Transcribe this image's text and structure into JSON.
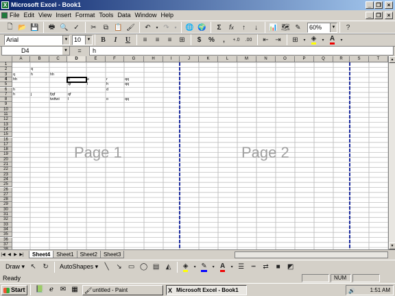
{
  "window": {
    "title": "Microsoft Excel - Book1"
  },
  "menu": [
    "File",
    "Edit",
    "View",
    "Insert",
    "Format",
    "Tools",
    "Data",
    "Window",
    "Help"
  ],
  "standard_toolbar": {
    "zoom": "60%"
  },
  "formatting_toolbar": {
    "font": "Arial",
    "size": "10"
  },
  "formula_bar": {
    "name_box": "D4",
    "fx": "=",
    "content": "h"
  },
  "columns": [
    "A",
    "B",
    "C",
    "D",
    "E",
    "F",
    "G",
    "H",
    "I",
    "J",
    "K",
    "L",
    "M",
    "N",
    "O",
    "P",
    "Q",
    "R",
    "S",
    "T"
  ],
  "rows": [
    "1",
    "2",
    "3",
    "4",
    "5",
    "6",
    "7",
    "8",
    "9",
    "10",
    "11",
    "12",
    "13",
    "14",
    "15",
    "16",
    "17",
    "18",
    "19",
    "20",
    "21",
    "22",
    "23",
    "24",
    "25",
    "26",
    "27",
    "28",
    "29",
    "30",
    "31",
    "32",
    "33",
    "34",
    "35",
    "36",
    "37",
    "38"
  ],
  "cells": [
    {
      "ref": "B2",
      "text": "q"
    },
    {
      "ref": "A3",
      "text": "q"
    },
    {
      "ref": "B3",
      "text": "h"
    },
    {
      "ref": "C3",
      "text": "hh"
    },
    {
      "ref": "A4",
      "text": "hh"
    },
    {
      "ref": "D4",
      "text": "h"
    },
    {
      "ref": "E4",
      "text": "e"
    },
    {
      "ref": "F4",
      "text": "r"
    },
    {
      "ref": "G4",
      "text": "qq"
    },
    {
      "ref": "D5",
      "text": "qf"
    },
    {
      "ref": "E5",
      "text": "l"
    },
    {
      "ref": "F5",
      "text": "h"
    },
    {
      "ref": "G5",
      "text": "qq"
    },
    {
      "ref": "A6",
      "text": "h"
    },
    {
      "ref": "F6",
      "text": "d"
    },
    {
      "ref": "A7",
      "text": "h"
    },
    {
      "ref": "B7",
      "text": "j"
    },
    {
      "ref": "C7",
      "text": "fjqf"
    },
    {
      "ref": "D7",
      "text": "qf"
    },
    {
      "ref": "C8",
      "text": "twttwi"
    },
    {
      "ref": "D8",
      "text": "l"
    },
    {
      "ref": "F8",
      "text": "o"
    },
    {
      "ref": "G8",
      "text": "qq"
    }
  ],
  "page_labels": [
    "Page 1",
    "Page 2"
  ],
  "sheet_tabs": [
    "Sheet4",
    "Sheet1",
    "Sheet2",
    "Sheet3"
  ],
  "drawing_toolbar": {
    "draw": "Draw",
    "autoshapes": "AutoShapes"
  },
  "status": {
    "ready": "Ready",
    "num": "NUM"
  },
  "taskbar": {
    "start": "Start",
    "tasks": [
      "untitled - Paint",
      "Microsoft Excel - Book1"
    ],
    "clock": "1:51 AM"
  },
  "colors": {
    "title_start": "#0a246a",
    "title_end": "#a6caf0",
    "page_break": "#1a2aa0"
  }
}
